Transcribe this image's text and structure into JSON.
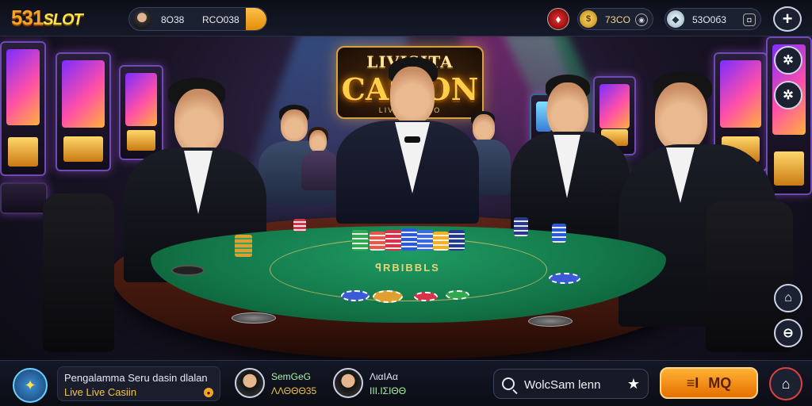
{
  "header": {
    "logo_number": "531",
    "logo_text": "SLOT",
    "user_name": "8O38",
    "user_balance": "RCO038",
    "coin_balance": "7ЗCO",
    "coin_symbol": "$",
    "gems_balance": "53O0б3"
  },
  "casino_sign": {
    "line1": "LIVISITA",
    "line2": "CASION",
    "line3": "LIVE CASINO"
  },
  "table": {
    "felt_text": "ꟼRBIBBLS"
  },
  "bottom": {
    "info_line1": "Pengalamma Seru dasin dlalan",
    "info_line2": "Live Live Casiin",
    "player1_name": "SemGeG",
    "player1_score": "ΛΛΘΘΘ35",
    "player2_name": "ΛιαΙΑα",
    "player2_score": "ΙΙΙ.ΙΣΙΘΘ",
    "search_value": "WolcSam lenn",
    "play_label": "MQ",
    "play_bars": "≡I"
  },
  "colors": {
    "accent": "#f5a524",
    "felt": "#127346",
    "rim": "#3a140b"
  }
}
